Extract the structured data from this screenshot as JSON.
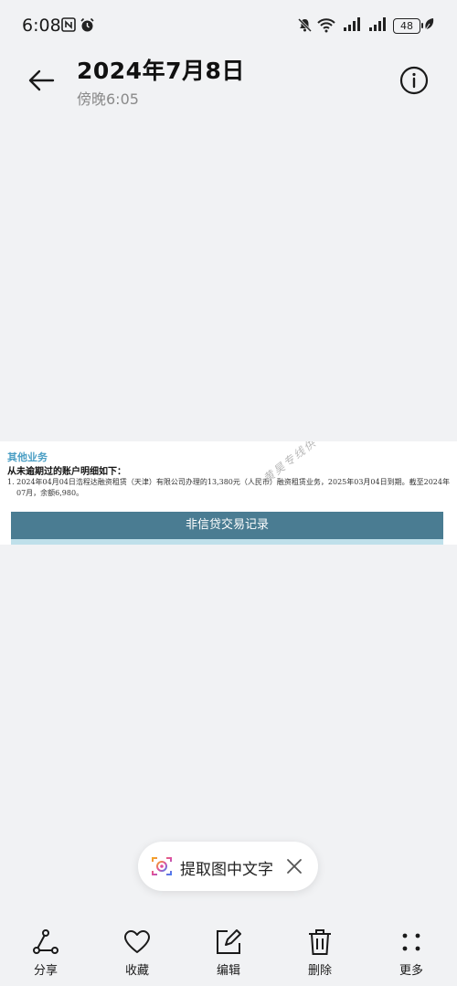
{
  "status_bar": {
    "time": "6:08",
    "battery_level": "48",
    "icons": [
      "nfc-icon",
      "alarm-icon",
      "mute-icon",
      "wifi-icon",
      "signal-icon",
      "signal-icon-2",
      "leaf-icon"
    ]
  },
  "header": {
    "title": "2024年7月8日",
    "subtitle": "傍晚6:05"
  },
  "image_content": {
    "section_title": "其他业务",
    "section_subtitle": "从未逾期过的账户明细如下：",
    "detail_line_1": "1. 2024年04月04日浩程达融资租赁（天津）有限公司办理的13,380元（人民币）融资租赁业务，2025年03月04日到期。截至2024年",
    "detail_line_2": "07月，余额6,980。",
    "watermark": "黄昊专线供",
    "record_bar_label": "非信贷交易记录"
  },
  "ocr_pill": {
    "label": "提取图中文字"
  },
  "toolbar": {
    "share_label": "分享",
    "favorite_label": "收藏",
    "edit_label": "编辑",
    "delete_label": "删除",
    "more_label": "更多"
  }
}
